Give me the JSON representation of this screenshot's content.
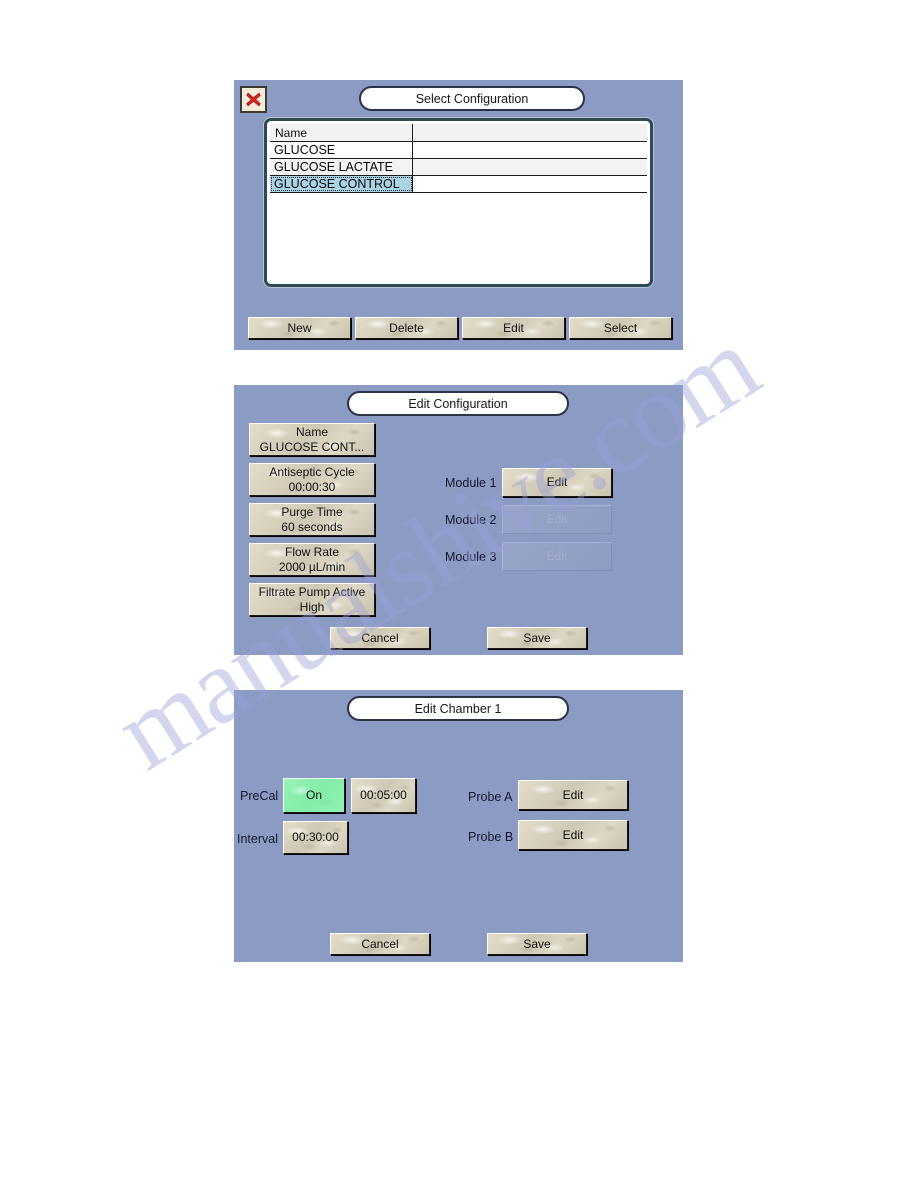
{
  "watermark": {
    "text": "manualshive.com"
  },
  "panels": {
    "select_configuration": {
      "title": "Select Configuration",
      "close_icon": "close-x-icon",
      "table": {
        "columns": [
          "Name",
          ""
        ],
        "rows": [
          {
            "name": "GLUCOSE",
            "selected": false
          },
          {
            "name": "GLUCOSE LACTATE",
            "selected": false
          },
          {
            "name": "GLUCOSE CONTROL",
            "selected": true
          }
        ]
      },
      "buttons": {
        "new": "New",
        "delete": "Delete",
        "edit": "Edit",
        "select": "Select"
      }
    },
    "edit_configuration": {
      "title": "Edit Configuration",
      "fields": [
        {
          "label": "Name",
          "value": "GLUCOSE CONT..."
        },
        {
          "label": "Antiseptic Cycle",
          "value": "00:00:30"
        },
        {
          "label": "Purge Time",
          "value": "60 seconds"
        },
        {
          "label": "Flow Rate",
          "value": "2000 µL/min"
        },
        {
          "label": "Filtrate Pump Active",
          "value": "High"
        }
      ],
      "modules": [
        {
          "label": "Module 1",
          "button": "Edit",
          "enabled": true
        },
        {
          "label": "Module 2",
          "button": "Edit",
          "enabled": false
        },
        {
          "label": "Module 3",
          "button": "Edit",
          "enabled": false
        }
      ],
      "buttons": {
        "cancel": "Cancel",
        "save": "Save"
      }
    },
    "edit_chamber": {
      "title": "Edit Chamber 1",
      "precal": {
        "label": "PreCal",
        "state": "On",
        "time": "00:05:00"
      },
      "interval": {
        "label": "Interval",
        "value": "00:30:00"
      },
      "probes": [
        {
          "label": "Probe A",
          "button": "Edit"
        },
        {
          "label": "Probe B",
          "button": "Edit"
        }
      ],
      "buttons": {
        "cancel": "Cancel",
        "save": "Save"
      }
    }
  },
  "colors": {
    "panel_bg": "#8c9bc4",
    "button_face": "#d8d2c0",
    "selection": "#a9d4e8",
    "toggle_on": "#8bf0ae",
    "listbox_border": "#2e4a52",
    "close_x": "#e02020"
  }
}
